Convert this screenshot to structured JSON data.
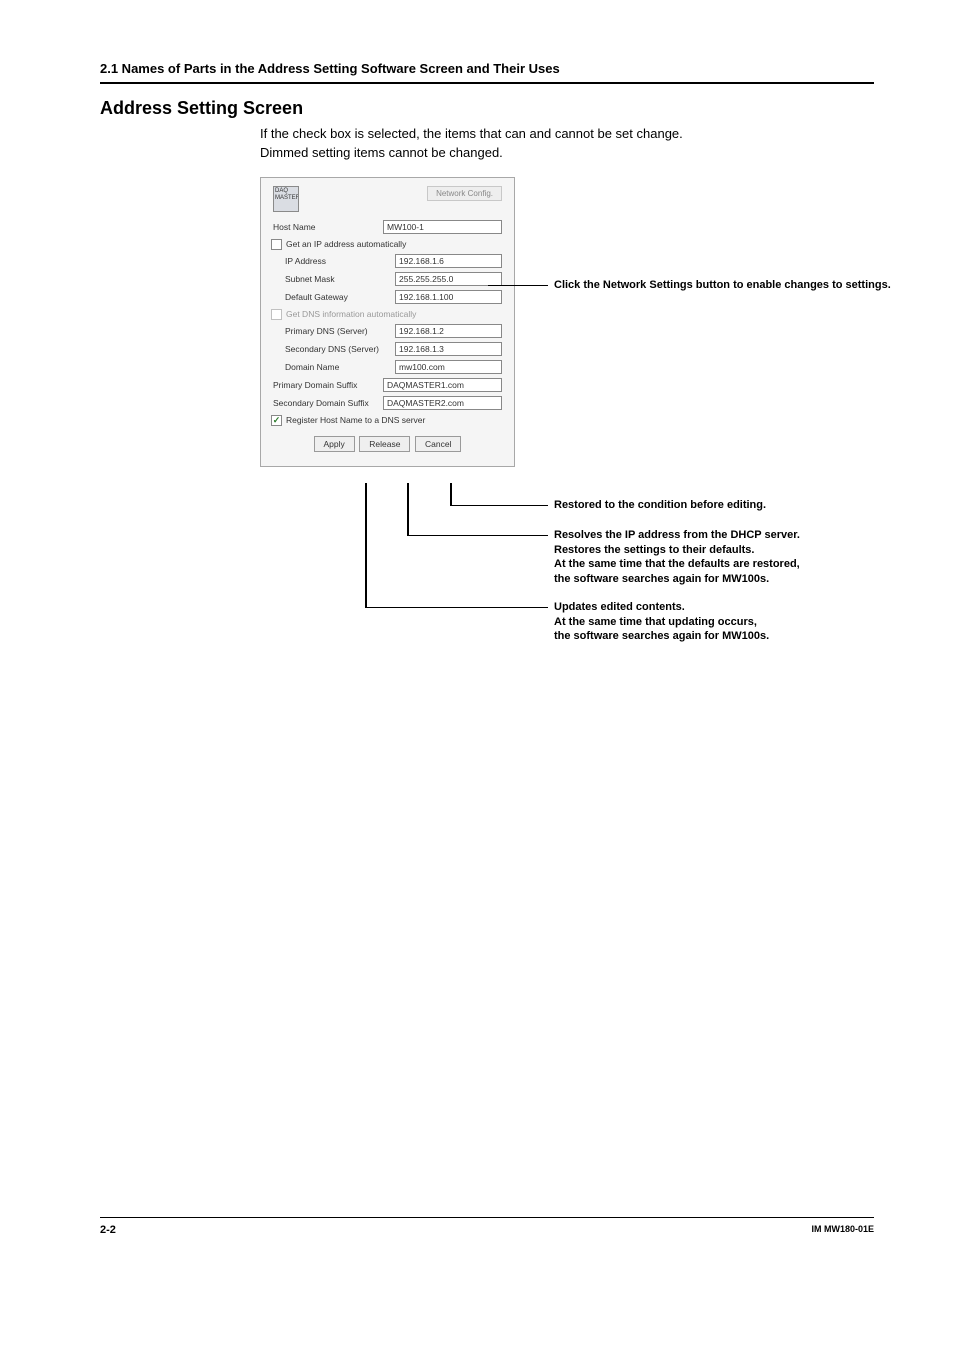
{
  "header": {
    "section_number_title": "2.1  Names of Parts in the Address Setting Software Screen and Their Uses"
  },
  "title": "Address Setting Screen",
  "intro_line1": "If the check box is selected, the items that can and cannot be set change.",
  "intro_line2": "Dimmed setting items cannot be changed.",
  "panel": {
    "network_config_btn": "Network Config.",
    "host_name_label": "Host Name",
    "host_name_value": "MW100-1",
    "chk_ip_auto": "Get an IP address automatically",
    "ip_addr_label": "IP Address",
    "ip_addr_value": "192.168.1.6",
    "subnet_label": "Subnet Mask",
    "subnet_value": "255.255.255.0",
    "gateway_label": "Default Gateway",
    "gateway_value": "192.168.1.100",
    "chk_dns_auto": "Get DNS information automatically",
    "pri_dns_label": "Primary DNS (Server)",
    "pri_dns_value": "192.168.1.2",
    "sec_dns_label": "Secondary DNS (Server)",
    "sec_dns_value": "192.168.1.3",
    "domain_label": "Domain Name",
    "domain_value": "mw100.com",
    "pri_suffix_label": "Primary Domain Suffix",
    "pri_suffix_value": "DAQMASTER1.com",
    "sec_suffix_label": "Secondary Domain Suffix",
    "sec_suffix_value": "DAQMASTER2.com",
    "chk_register": "Register Host Name to a DNS server",
    "apply_btn": "Apply",
    "release_btn": "Release",
    "cancel_btn": "Cancel"
  },
  "annotations": {
    "net_button": "Click the Network Settings button to enable changes to settings.",
    "cancel": "Restored to the condition before editing.",
    "release_l1": "Resolves the IP address from the DHCP server.",
    "release_l2": "Restores the settings to their defaults.",
    "release_l3": "At the same time that the defaults are restored,",
    "release_l4": "the software searches again for MW100s.",
    "apply_l1": "Updates edited contents.",
    "apply_l2": "At the same time that updating occurs,",
    "apply_l3": "the software searches again for MW100s."
  },
  "footer": {
    "page": "2-2",
    "doc": "IM MW180-01E"
  }
}
